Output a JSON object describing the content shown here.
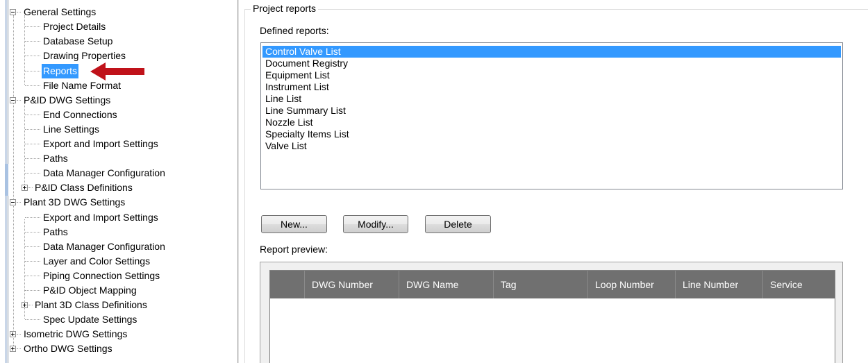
{
  "tree": {
    "items": [
      {
        "label": "General Settings"
      },
      {
        "label": "Project Details"
      },
      {
        "label": "Database Setup"
      },
      {
        "label": "Drawing Properties"
      },
      {
        "label": "Reports",
        "selected": true
      },
      {
        "label": "File Name Format"
      },
      {
        "label": "P&ID DWG Settings"
      },
      {
        "label": "End Connections"
      },
      {
        "label": "Line Settings"
      },
      {
        "label": "Export and Import Settings"
      },
      {
        "label": "Paths"
      },
      {
        "label": "Data Manager Configuration"
      },
      {
        "label": "P&ID Class Definitions"
      },
      {
        "label": "Plant 3D DWG Settings"
      },
      {
        "label": "Export and Import Settings"
      },
      {
        "label": "Paths"
      },
      {
        "label": "Data Manager Configuration"
      },
      {
        "label": "Layer and Color Settings"
      },
      {
        "label": "Piping Connection Settings"
      },
      {
        "label": "P&ID Object Mapping"
      },
      {
        "label": "Plant 3D Class Definitions"
      },
      {
        "label": "Spec Update Settings"
      },
      {
        "label": "Isometric DWG Settings"
      },
      {
        "label": "Ortho DWG Settings"
      }
    ]
  },
  "group_title": "Project reports",
  "defined_reports_label": "Defined reports:",
  "reports": [
    {
      "label": "Control Valve List",
      "selected": true
    },
    {
      "label": "Document Registry"
    },
    {
      "label": "Equipment List"
    },
    {
      "label": "Instrument List"
    },
    {
      "label": "Line List"
    },
    {
      "label": "Line Summary List"
    },
    {
      "label": "Nozzle List"
    },
    {
      "label": "Specialty Items List"
    },
    {
      "label": "Valve List"
    }
  ],
  "buttons": {
    "new": "New...",
    "modify": "Modify...",
    "delete": "Delete"
  },
  "preview_label": "Report preview:",
  "grid_columns": [
    "",
    "DWG Number",
    "DWG Name",
    "Tag",
    "Loop Number",
    "Line Number",
    "Service"
  ],
  "colors": {
    "selection": "#3399ff",
    "arrow": "#c0121a",
    "grid_header": "#707070"
  }
}
